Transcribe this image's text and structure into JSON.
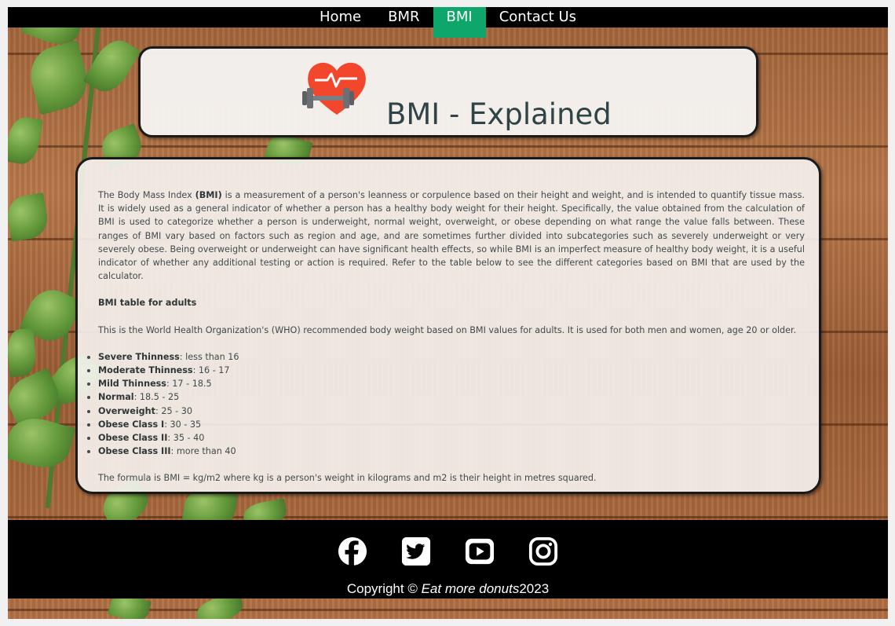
{
  "nav": {
    "items": [
      {
        "label": "Home",
        "active": false
      },
      {
        "label": "BMR",
        "active": false
      },
      {
        "label": "BMI",
        "active": true
      },
      {
        "label": "Contact Us",
        "active": false
      }
    ],
    "active_color": "#0ea66b"
  },
  "hero": {
    "logo_icon": "heart-dumbbell-icon",
    "title": "BMI - Explained"
  },
  "article": {
    "intro_before": "The Body Mass Index ",
    "intro_bold": "(BMI)",
    "intro_after": " is a measurement of a person's leanness or corpulence based on their height and weight, and is intended to quantify tissue mass. It is widely used as a general indicator of whether a person has a healthy body weight for their height. Specifically, the value obtained from the calculation of BMI is used to categorize whether a person is underweight, normal weight, overweight, or obese depending on what range the value falls between. These ranges of BMI vary based on factors such as region and age, and are sometimes further divided into subcategories such as severely underweight or very severely obese. Being overweight or underweight can have significant health effects, so while BMI is an imperfect measure of healthy body weight, it is a useful indicator of whether any additional testing or action is required. Refer to the table below to see the different categories based on BMI that are used by the calculator.",
    "table_heading": "BMI table for adults",
    "who_text": "This is the World Health Organization's (WHO) recommended body weight based on BMI values for adults. It is used for both men and women, age 20 or older.",
    "categories": [
      {
        "name": "Severe Thinness",
        "range": ": less than 16"
      },
      {
        "name": "Moderate Thinness",
        "range": ": 16 - 17"
      },
      {
        "name": "Mild Thinness",
        "range": ": 17 - 18.5"
      },
      {
        "name": "Normal",
        "range": ": 18.5 - 25"
      },
      {
        "name": "Overweight",
        "range": ": 25 - 30"
      },
      {
        "name": "Obese Class I",
        "range": ": 30 - 35"
      },
      {
        "name": "Obese Class II",
        "range": ": 35 - 40"
      },
      {
        "name": "Obese Class III",
        "range": ": more than 40"
      }
    ],
    "formula": "The formula is BMI = kg/m2 where kg is a person's weight in kilograms and m2 is their height in metres squared."
  },
  "footer": {
    "social": [
      {
        "icon": "facebook-icon"
      },
      {
        "icon": "twitter-icon"
      },
      {
        "icon": "youtube-icon"
      },
      {
        "icon": "instagram-icon"
      }
    ],
    "copyright_prefix": "Copyright © ",
    "copyright_name": "Eat more donuts",
    "copyright_year": "2023"
  }
}
